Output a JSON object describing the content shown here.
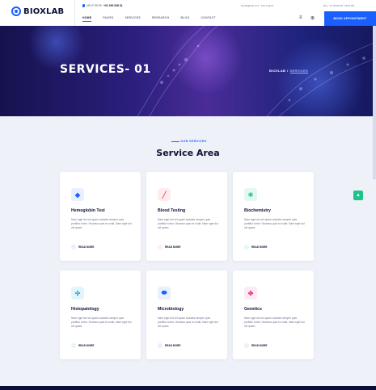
{
  "header": {
    "logo_text": "BIOXLAB",
    "help_label": "HELP DESK",
    "phone": "+01 390 038 01",
    "email_info": "bioxlab@info.com · 24/7 support",
    "hours_info": "Mon - Fri 09:00 AM - 05:00 PM",
    "nav": [
      "HOME",
      "PAGES",
      "SERVICES",
      "RESEARCH",
      "BLOG",
      "CONTACT"
    ],
    "book_button": "BOOK APPOINTMENT",
    "menu_icon": "hamburger-icon",
    "cart_icon": "cart-icon"
  },
  "hero": {
    "title": "SERVICES- 01",
    "breadcrumb_home": "BIOXLAB",
    "breadcrumb_sep": "/",
    "breadcrumb_current": "SERVICES"
  },
  "section": {
    "kicker": "OUR SERVICES",
    "title": "Service Area"
  },
  "cards": [
    {
      "title": "Hemoglobin Test",
      "desc": "Nam eget dui vel quam sodales semper quis porttitor tortor. Vivamus quis ex nulla. Nam eget dui vel quam.",
      "read": "READ MORE",
      "icon": "shield-icon",
      "icon_glyph": "◆",
      "accent": "#1a5fff",
      "tint": "#e8efff"
    },
    {
      "title": "Blood Testing",
      "desc": "Nam eget dui vel quam sodales semper quis porttitor tortor. Vivamus quis ex nulla. Nam eget dui vel quam.",
      "read": "READ MORE",
      "icon": "syringe-icon",
      "icon_glyph": "╱",
      "accent": "#ff4d6d",
      "tint": "#ffecef"
    },
    {
      "title": "Biochemistry",
      "desc": "Nam eget dui vel quam sodales semper quis porttitor tortor. Vivamus quis ex nulla. Nam eget dui vel quam.",
      "read": "READ MORE",
      "icon": "molecule-icon",
      "icon_glyph": "⚛",
      "accent": "#14b884",
      "tint": "#e4f8f1"
    },
    {
      "title": "Histopatology",
      "desc": "Nam eget dui vel quam sodales semper quis porttitor tortor. Vivamus quis ex nulla. Nam eget dui vel quam.",
      "read": "READ MORE",
      "icon": "dna-icon",
      "icon_glyph": "✣",
      "accent": "#1aa6d9",
      "tint": "#e3f5fc"
    },
    {
      "title": "Microbiology",
      "desc": "Nam eget dui vel quam sodales semper quis porttitor tortor. Vivamus quis ex nulla. Nam eget dui vel quam.",
      "read": "READ MORE",
      "icon": "capsule-icon",
      "icon_glyph": "⬬",
      "accent": "#1a5fff",
      "tint": "#e8efff"
    },
    {
      "title": "Genetics",
      "desc": "Nam eget dui vel quam sodales semper quis porttitor tortor. Vivamus quis ex nulla. Nam eget dui vel quam.",
      "read": "READ MORE",
      "icon": "gene-icon",
      "icon_glyph": "✤",
      "accent": "#e83a8a",
      "tint": "#fdebf4"
    }
  ],
  "float_button": {
    "icon": "arrow-up-icon",
    "glyph": "▲",
    "color": "#1cc48b"
  }
}
